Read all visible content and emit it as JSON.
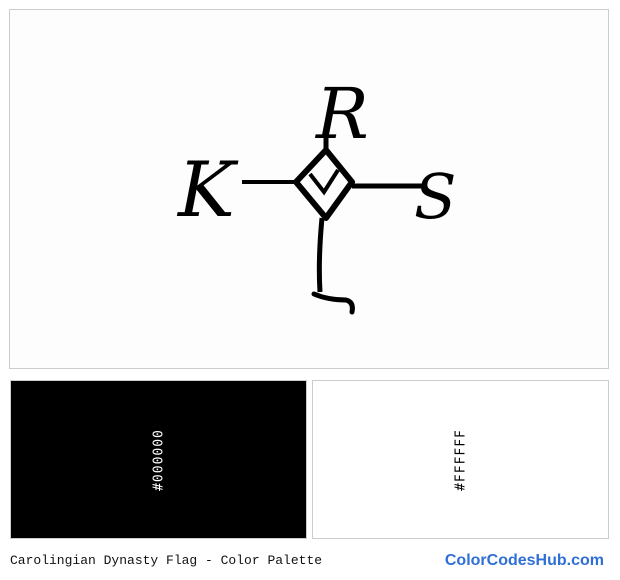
{
  "flag": {
    "name": "Carolingian Dynasty Flag",
    "background_color": "#FDFDFD",
    "monogram_color": "#000000",
    "monogram_letters": [
      "K",
      "R",
      "L",
      "S"
    ]
  },
  "palette": [
    {
      "hex": "#000000",
      "swatch_color": "#000000",
      "text_color": "#FFFFFF"
    },
    {
      "hex": "#FFFFFF",
      "swatch_color": "#FFFFFF",
      "text_color": "#000000"
    }
  ],
  "footer": {
    "caption": "Carolingian Dynasty Flag - Color Palette",
    "brand": "ColorCodesHub.com",
    "brand_color": "#2f6fd6"
  }
}
